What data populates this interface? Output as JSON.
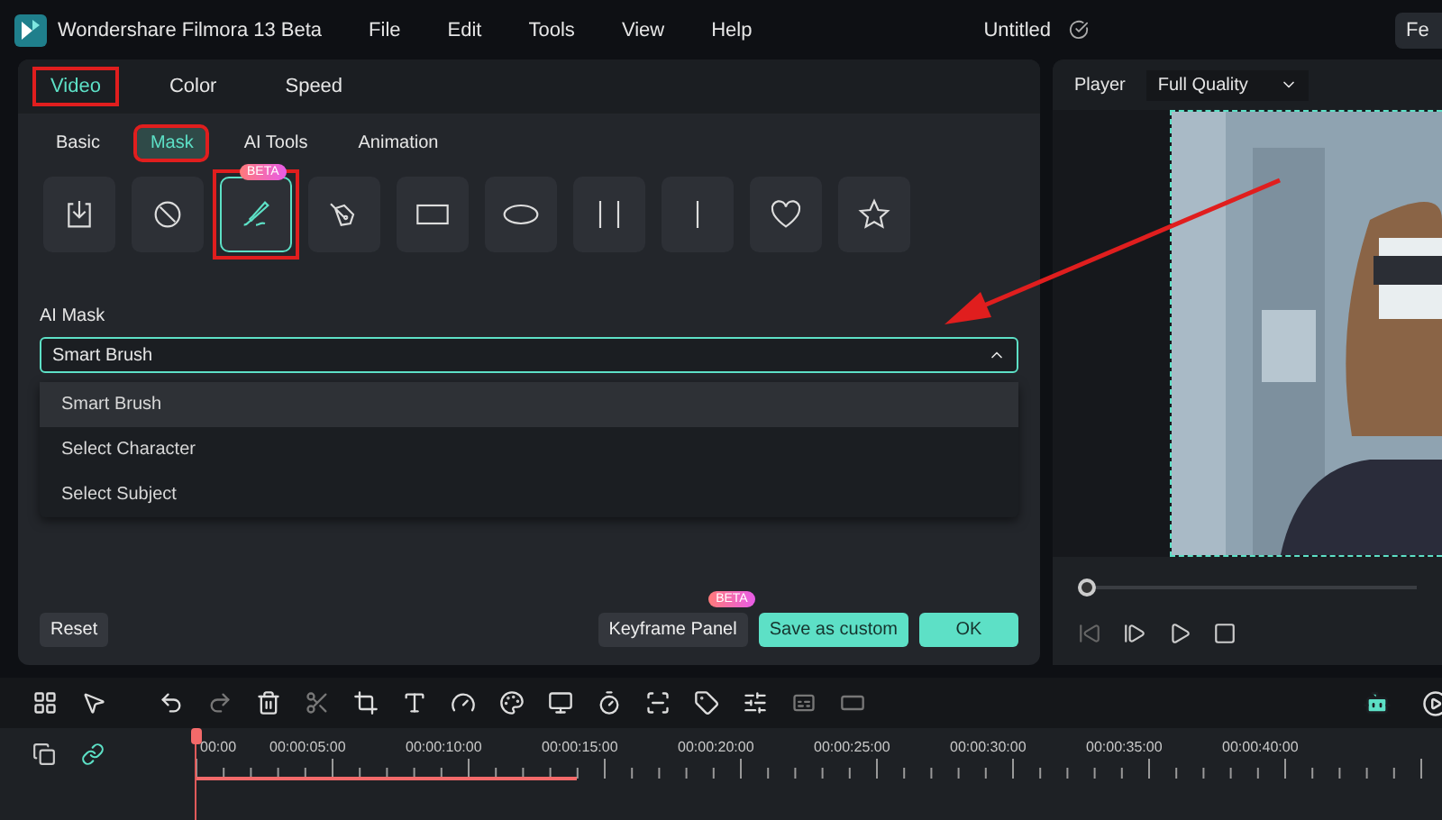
{
  "app": {
    "title": "Wondershare Filmora 13 Beta",
    "menu": [
      "File",
      "Edit",
      "Tools",
      "View",
      "Help"
    ],
    "project": "Untitled",
    "feedback": "Fe"
  },
  "tabs": [
    {
      "label": "Video",
      "selected": true,
      "highlighted": true
    },
    {
      "label": "Color",
      "selected": false,
      "highlighted": false
    },
    {
      "label": "Speed",
      "selected": false,
      "highlighted": false
    }
  ],
  "subtabs": [
    {
      "label": "Basic",
      "selected": false,
      "highlighted": false
    },
    {
      "label": "Mask",
      "selected": true,
      "highlighted": true
    },
    {
      "label": "AI Tools",
      "selected": false,
      "highlighted": false
    },
    {
      "label": "Animation",
      "selected": false,
      "highlighted": false
    }
  ],
  "mask_shapes": [
    {
      "kind": "import",
      "selected": false
    },
    {
      "kind": "none",
      "selected": false
    },
    {
      "kind": "brush",
      "selected": true,
      "badge": "BETA",
      "highlighted": true
    },
    {
      "kind": "pen",
      "selected": false
    },
    {
      "kind": "rectangle",
      "selected": false
    },
    {
      "kind": "ellipse",
      "selected": false
    },
    {
      "kind": "double-line",
      "selected": false
    },
    {
      "kind": "single-line",
      "selected": false
    },
    {
      "kind": "heart",
      "selected": false
    },
    {
      "kind": "star",
      "selected": false
    }
  ],
  "ai_mask": {
    "label": "AI Mask",
    "value": "Smart Brush",
    "expanded": true,
    "options": [
      {
        "label": "Smart Brush",
        "selected": true
      },
      {
        "label": "Select Character",
        "selected": false
      },
      {
        "label": "Select Subject",
        "selected": false
      }
    ]
  },
  "footer": {
    "reset": "Reset",
    "keyframe": "Keyframe Panel",
    "keyframe_badge": "BETA",
    "save": "Save as custom",
    "ok": "OK"
  },
  "player": {
    "label": "Player",
    "quality": "Full Quality",
    "progress": {
      "level": 0
    }
  },
  "timeline": {
    "tools": [
      {
        "kind": "grid",
        "disabled": false
      },
      {
        "kind": "select",
        "disabled": false
      },
      {
        "kind": "undo",
        "disabled": false
      },
      {
        "kind": "redo",
        "disabled": true
      },
      {
        "kind": "delete",
        "disabled": false
      },
      {
        "kind": "cut",
        "disabled": true
      },
      {
        "kind": "crop",
        "disabled": false
      },
      {
        "kind": "text",
        "disabled": false
      },
      {
        "kind": "speed",
        "disabled": false
      },
      {
        "kind": "color",
        "disabled": false
      },
      {
        "kind": "monitor",
        "disabled": false
      },
      {
        "kind": "timer",
        "disabled": false
      },
      {
        "kind": "focus",
        "disabled": false
      },
      {
        "kind": "tag",
        "disabled": false
      },
      {
        "kind": "adjust",
        "disabled": false
      },
      {
        "kind": "caption",
        "disabled": true
      },
      {
        "kind": "frame",
        "disabled": true
      }
    ],
    "times": [
      "00:00",
      "00:00:05:00",
      "00:00:10:00",
      "00:00:15:00",
      "00:00:20:00",
      "00:00:25:00",
      "00:00:30:00",
      "00:00:35:00",
      "00:00:40:00"
    ]
  }
}
